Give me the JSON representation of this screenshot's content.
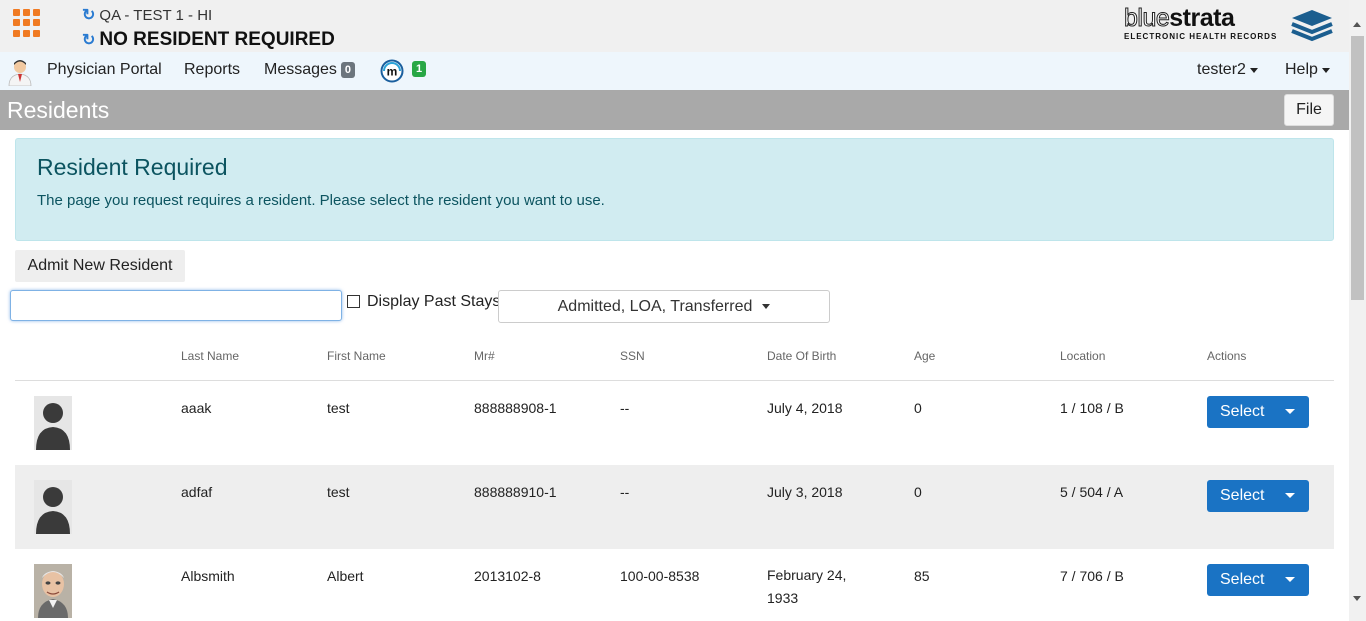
{
  "header": {
    "org_name": "QA - TEST 1 - HI",
    "resident_status": "NO RESIDENT REQUIRED",
    "logo_primary": "blue",
    "logo_secondary": "strata",
    "logo_tagline": "ELECTRONIC HEALTH RECORDS",
    "apps_icon": "apps-grid-icon",
    "refresh_icon": "refresh-icon",
    "brand_orange": "#f07a22"
  },
  "nav": {
    "physician_portal": "Physician Portal",
    "reports": "Reports",
    "messages_label": "Messages",
    "messages_count": "0",
    "m_count": "1",
    "user": "tester2",
    "help": "Help"
  },
  "section": {
    "title": "Residents",
    "file_button": "File"
  },
  "alert": {
    "title": "Resident Required",
    "message": "The page you request requires a resident. Please select the resident you want to use."
  },
  "toolbar": {
    "admit_button": "Admit New Resident",
    "search_value": "",
    "display_past_stays": "Display Past Stays",
    "status_filter": "Admitted, LOA, Transferred"
  },
  "table": {
    "columns": [
      "Last Name",
      "First Name",
      "Mr#",
      "SSN",
      "Date Of Birth",
      "Age",
      "Location",
      "Actions"
    ],
    "rows": [
      {
        "last": "aaak",
        "first": "test",
        "mr": "888888908-1",
        "ssn": "--",
        "dob": "July 4, 2018",
        "age": "0",
        "location": "1 / 108 / B",
        "action": "Select",
        "photo": "silhouette"
      },
      {
        "last": "adfaf",
        "first": "test",
        "mr": "888888910-1",
        "ssn": "--",
        "dob": "July 3, 2018",
        "age": "0",
        "location": "5 / 504 / A",
        "action": "Select",
        "photo": "silhouette"
      },
      {
        "last": "Albsmith",
        "first": "Albert",
        "mr": "2013102-8",
        "ssn": "100-00-8538",
        "dob": "February 24, 1933",
        "age": "85",
        "location": "7 / 706 / B",
        "action": "Select",
        "photo": "portrait"
      }
    ]
  },
  "colors": {
    "primary_button": "#1a73c4",
    "alert_bg": "#d1ecf1",
    "alert_text": "#0c5460",
    "section_bg": "#a9a9a9"
  }
}
